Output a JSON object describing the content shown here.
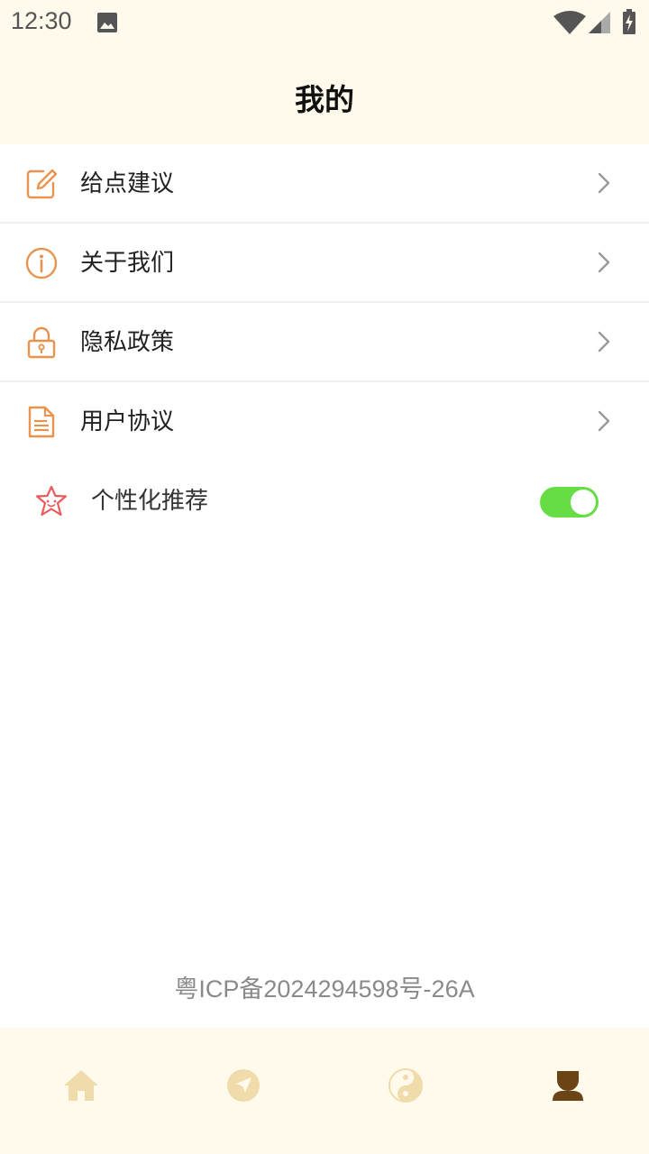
{
  "status_bar": {
    "time": "12:30",
    "icons": [
      "image-icon",
      "wifi-icon",
      "signal-icon",
      "battery-charging-icon"
    ]
  },
  "header": {
    "title": "我的"
  },
  "menu": {
    "items": [
      {
        "label": "给点建议",
        "icon": "edit-icon"
      },
      {
        "label": "关于我们",
        "icon": "info-icon"
      },
      {
        "label": "隐私政策",
        "icon": "lock-icon"
      },
      {
        "label": "用户协议",
        "icon": "document-icon"
      }
    ]
  },
  "personalization": {
    "label": "个性化推荐",
    "icon": "star-face-icon",
    "enabled": true
  },
  "footer": {
    "icp": "粤ICP备2024294598号-26A"
  },
  "bottom_nav": {
    "items": [
      {
        "icon": "home-icon",
        "active": false
      },
      {
        "icon": "compass-icon",
        "active": false
      },
      {
        "icon": "yin-yang-icon",
        "active": false
      },
      {
        "icon": "profile-icon",
        "active": true
      }
    ]
  },
  "colors": {
    "accent": "#e8944f",
    "toggle_on": "#66dd44",
    "bar_background": "#fffaeb",
    "nav_inactive": "#f0dcaa",
    "nav_active": "#6b4415"
  }
}
